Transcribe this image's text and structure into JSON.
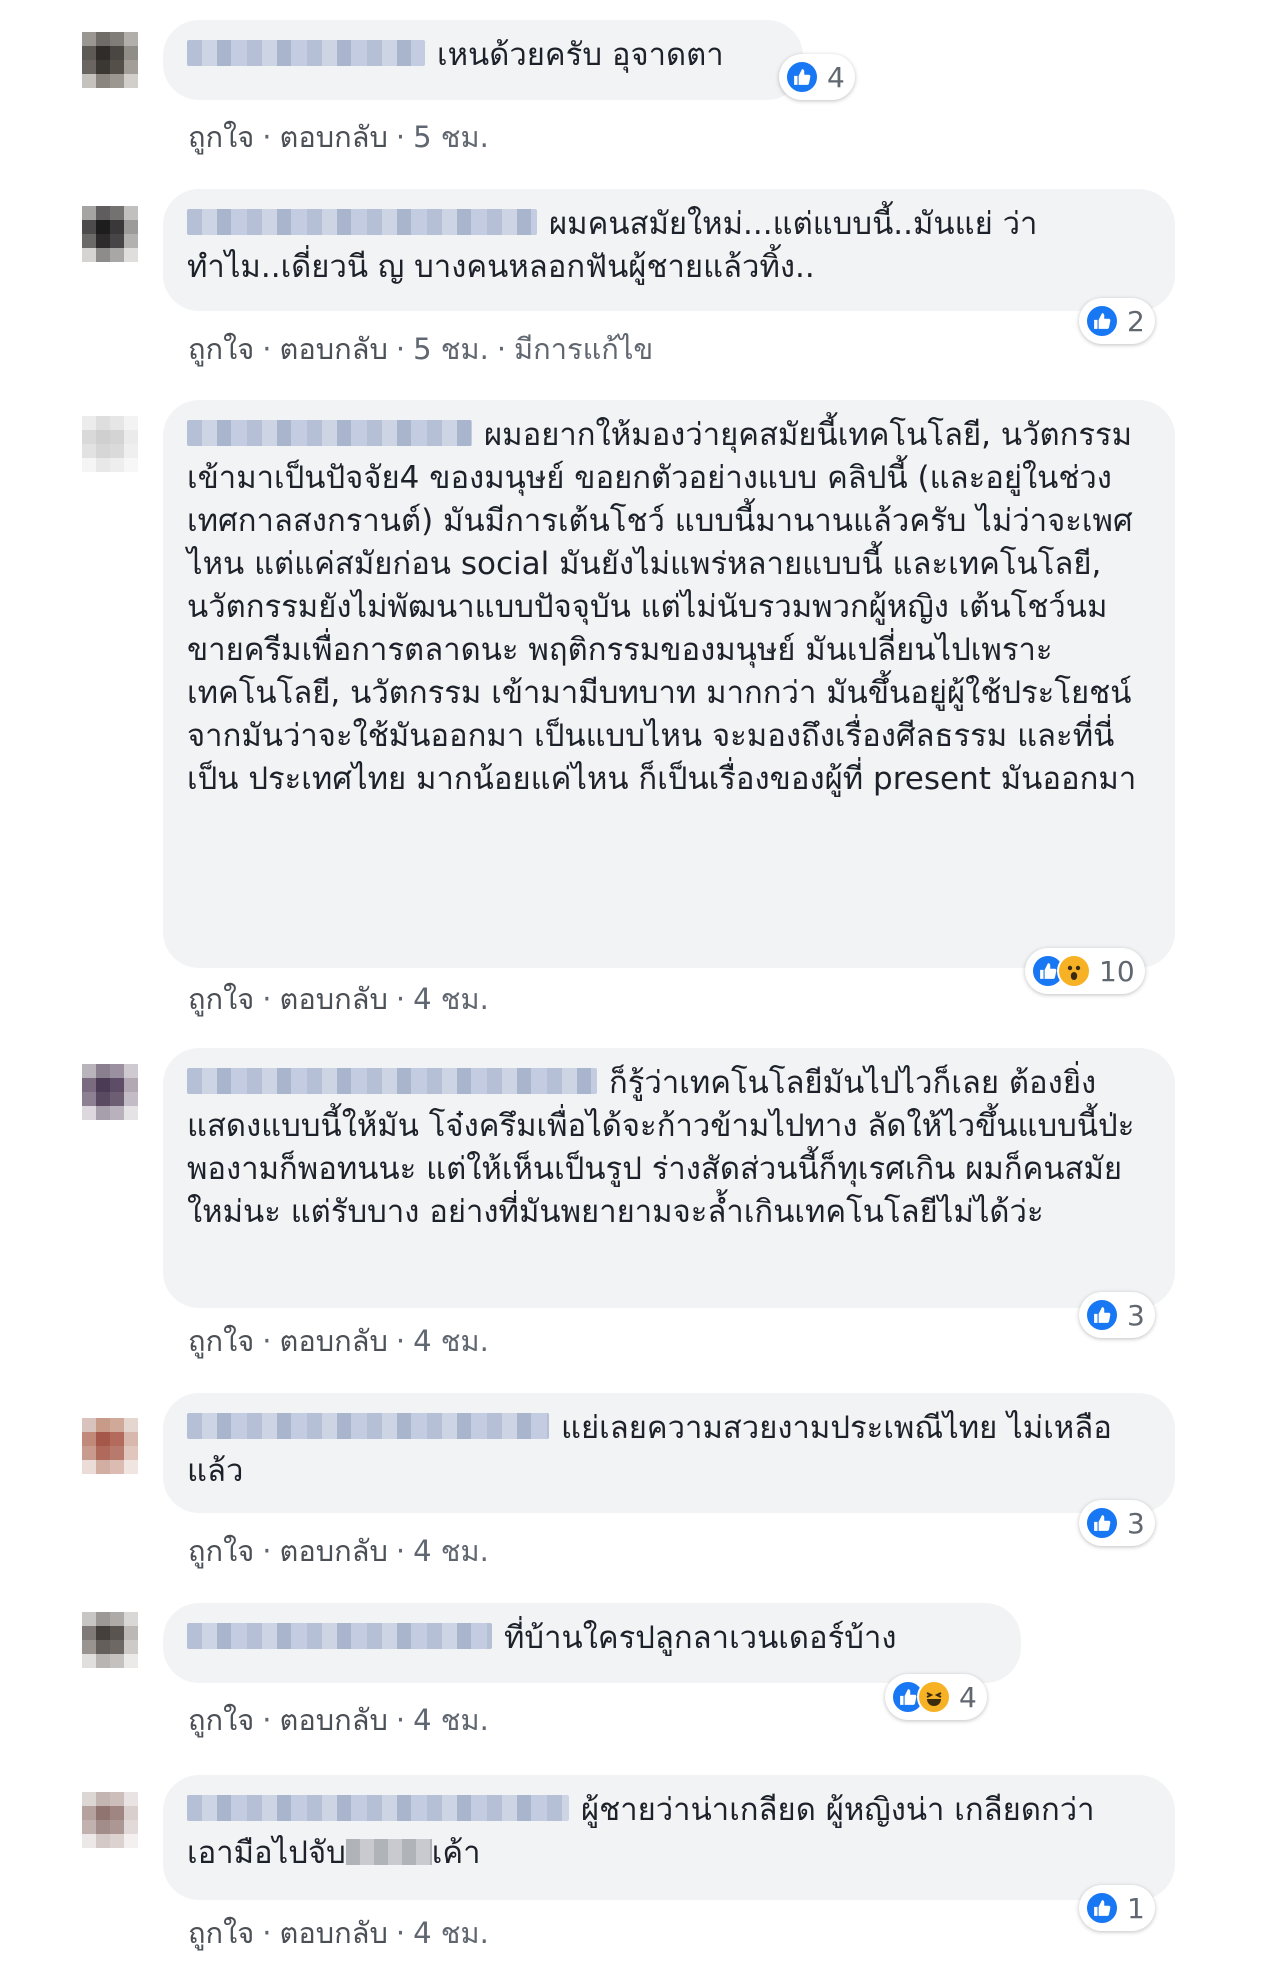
{
  "comments": [
    {
      "text": "เหนด้วยครับ อุจาดตา",
      "actions": {
        "like": "ถูกใจ",
        "reply": "ตอบกลับ",
        "time": "5 ชม.",
        "edited": ""
      },
      "reactions": {
        "types": [
          "like"
        ],
        "count": "4"
      }
    },
    {
      "text": "ผมคนสมัยใหม่...แต่แบบนี้..มันแย่ ว่าทำไม..เดี่ยวนี ญ บางคนหลอกฟันผู้ชายแล้วทิ้ง..",
      "actions": {
        "like": "ถูกใจ",
        "reply": "ตอบกลับ",
        "time": "5 ชม.",
        "edited": "มีการแก้ไข"
      },
      "reactions": {
        "types": [
          "like"
        ],
        "count": "2"
      }
    },
    {
      "text": "ผมอยากให้มองว่ายุคสมัยนี้เทคโนโลยี, นวัตกรรมเข้ามาเป็นปัจจัย4 ของมนุษย์ ขอยกตัวอย่างแบบ คลิปนี้ (และอยู่ในช่วงเทศกาลสงกรานต์) มันมีการเต้นโชว์ แบบนี้มานานแล้วครับ ไม่ว่าจะเพศไหน แต่แค่สมัยก่อน social มันยังไม่แพร่หลายแบบนี้ และเทคโนโลยี, นวัตกรรมยังไม่พัฒนาแบบปัจจุบัน แต่ไม่นับรวมพวกผู้หญิง เต้นโชว์นมขายครีมเพื่อการตลาดนะ พฤติกรรมของมนุษย์ มันเปลี่ยนไปเพราะ เทคโนโลยี, นวัตกรรม เข้ามามีบทบาท มากกว่า มันขึ้นอยู่ผู้ใช้ประโยชน์จากมันว่าจะใช้มันออกมา เป็นแบบไหน จะมองถึงเรื่องศีลธรรม และที่นี่เป็น ประเทศไทย มากน้อยแค่ไหน ก็เป็นเรื่องของผู้ที่ present มันออกมา",
      "actions": {
        "like": "ถูกใจ",
        "reply": "ตอบกลับ",
        "time": "4 ชม.",
        "edited": ""
      },
      "reactions": {
        "types": [
          "like",
          "wow"
        ],
        "count": "10"
      }
    },
    {
      "text": "ก็รู้ว่าเทคโนโลยีมันไปไวก็เลย ต้องยิ่งแสดงแบบนี้ให้มัน โจ๋งครึมเพื่อได้จะก้าวข้ามไปทาง ลัดให้ไวขึ้นแบบนี้ป่ะ พองามก็พอทนนะ แต่ให้เห็นเป็นรูป ร่างสัดส่วนนี้ก็ทุเรศเกิน ผมก็คนสมัย ใหม่นะ แต่รับบาง อย่างที่มันพยายามจะล้ำเกินเทคโนโลยีไม่ได้ว่ะ",
      "actions": {
        "like": "ถูกใจ",
        "reply": "ตอบกลับ",
        "time": "4 ชม.",
        "edited": ""
      },
      "reactions": {
        "types": [
          "like"
        ],
        "count": "3"
      }
    },
    {
      "text": "แย่เลยความสวยงามประเพณีไทย ไม่เหลือแล้ว",
      "actions": {
        "like": "ถูกใจ",
        "reply": "ตอบกลับ",
        "time": "4 ชม.",
        "edited": ""
      },
      "reactions": {
        "types": [
          "like"
        ],
        "count": "3"
      }
    },
    {
      "text": "ที่บ้านใครปลูกลาเวนเดอร์บ้าง",
      "actions": {
        "like": "ถูกใจ",
        "reply": "ตอบกลับ",
        "time": "4 ชม.",
        "edited": ""
      },
      "reactions": {
        "types": [
          "like",
          "haha"
        ],
        "count": "4"
      }
    },
    {
      "text": "ผู้ชายว่าน่าเกลียด ผู้หญิงน่า เกลียดกว่า เอามือไปจับ",
      "text_after": "เค้า",
      "actions": {
        "like": "ถูกใจ",
        "reply": "ตอบกลับ",
        "time": "4 ชม.",
        "edited": ""
      },
      "reactions": {
        "types": [
          "like"
        ],
        "count": "1"
      }
    }
  ],
  "icon_names": [
    "like-icon",
    "wow-icon",
    "haha-icon"
  ],
  "colors": {
    "like": "#1877f2",
    "emoji": "#f7b125",
    "bubble": "#f2f3f5",
    "meta": "#606770",
    "text": "#1d2129"
  }
}
